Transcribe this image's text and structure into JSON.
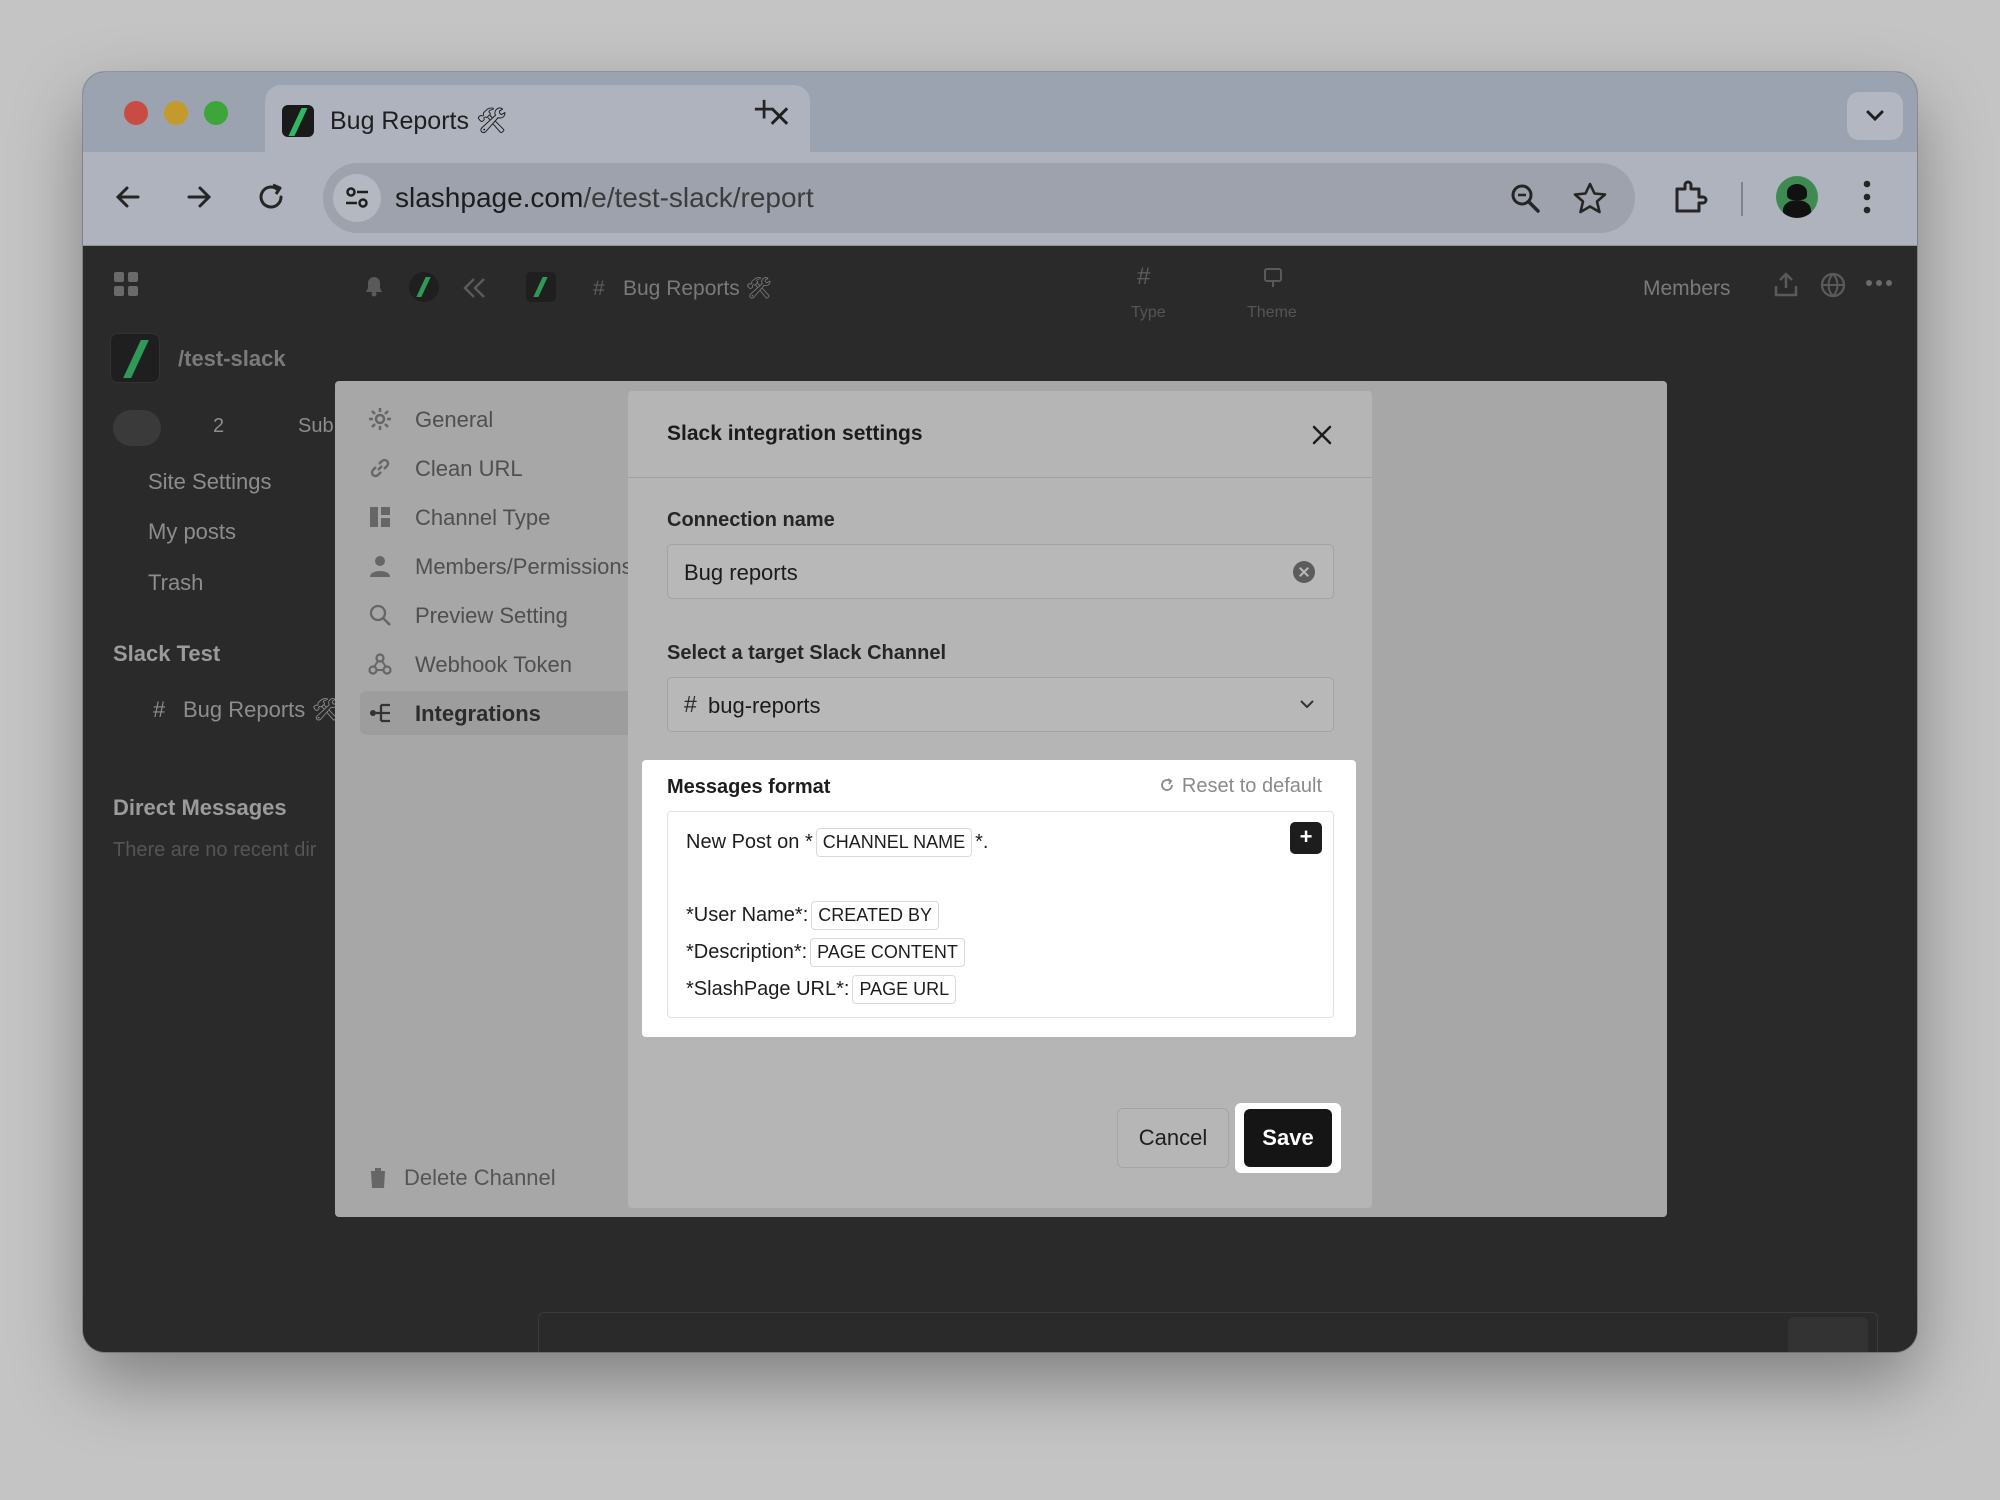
{
  "browser": {
    "tab_title": "Bug Reports 🛠",
    "tab_close": "✕",
    "new_tab": "+",
    "url_host": "slashpage.com",
    "url_path": "/e/test-slack/report"
  },
  "app": {
    "topbar": {
      "channel_title": "Bug Reports 🛠",
      "type_label": "Type",
      "theme_label": "Theme",
      "members_label": "Members"
    },
    "sidebar": {
      "workspace": "/test-slack",
      "member_count": "2",
      "subscribe_label": "Sub",
      "items": [
        "Site Settings",
        "My posts",
        "Trash"
      ],
      "section_title": "Slack Test",
      "channel": "Bug Reports 🛠",
      "dm_title": "Direct Messages",
      "dm_empty": "There are no recent dir"
    }
  },
  "settings_nav": {
    "items": [
      {
        "label": "General",
        "icon": "gear-icon"
      },
      {
        "label": "Clean URL",
        "icon": "link-icon"
      },
      {
        "label": "Channel Type",
        "icon": "layout-icon"
      },
      {
        "label": "Members/Permissions",
        "icon": "person-icon"
      },
      {
        "label": "Preview Setting",
        "icon": "magnifier-icon"
      },
      {
        "label": "Webhook Token",
        "icon": "webhook-icon"
      },
      {
        "label": "Integrations",
        "icon": "integrations-icon"
      }
    ],
    "active": "Integrations",
    "delete_label": "Delete Channel"
  },
  "modal": {
    "title": "Slack integration settings",
    "connection_label": "Connection name",
    "connection_value": "Bug reports",
    "channel_label": "Select a target Slack Channel",
    "channel_value": "bug-reports",
    "messages": {
      "title": "Messages format",
      "reset_label": "Reset to default",
      "line1_prefix": "New Post on *",
      "line1_chip": "CHANNEL NAME",
      "line1_suffix": "*.",
      "line2_prefix": "*User Name*:",
      "line2_chip": "CREATED BY",
      "line3_prefix": "*Description*:",
      "line3_chip": "PAGE CONTENT",
      "line4_prefix": "*SlashPage URL*:",
      "line4_chip": "PAGE URL",
      "insert_label": "+"
    },
    "cancel_label": "Cancel",
    "save_label": "Save"
  }
}
